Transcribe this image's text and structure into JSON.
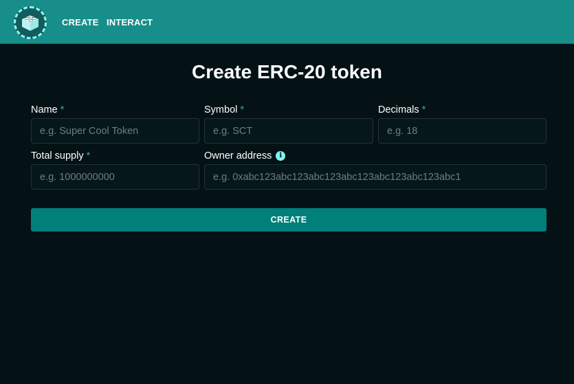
{
  "nav": {
    "logo_icon": "lego-brick-icon",
    "links": [
      "CREATE",
      "INTERACT"
    ]
  },
  "page": {
    "title": "Create ERC-20 token"
  },
  "form": {
    "name": {
      "label": "Name",
      "required_mark": "*",
      "placeholder": "e.g. Super Cool Token",
      "value": ""
    },
    "symbol": {
      "label": "Symbol",
      "required_mark": "*",
      "placeholder": "e.g. SCT",
      "value": ""
    },
    "decimals": {
      "label": "Decimals",
      "required_mark": "*",
      "placeholder": "e.g. 18",
      "value": ""
    },
    "total_supply": {
      "label": "Total supply",
      "required_mark": "*",
      "placeholder": "e.g. 1000000000",
      "value": ""
    },
    "owner_address": {
      "label": "Owner address",
      "info_icon": "info-icon",
      "info_glyph": "i",
      "placeholder": "e.g. 0xabc123abc123abc123abc123abc123abc123abc1",
      "value": ""
    },
    "submit_label": "CREATE"
  },
  "colors": {
    "header_bg": "#178e8a",
    "page_bg": "#041216",
    "button_bg": "#007f7b",
    "required": "#3aa7a3",
    "info": "#7ff4f0"
  }
}
